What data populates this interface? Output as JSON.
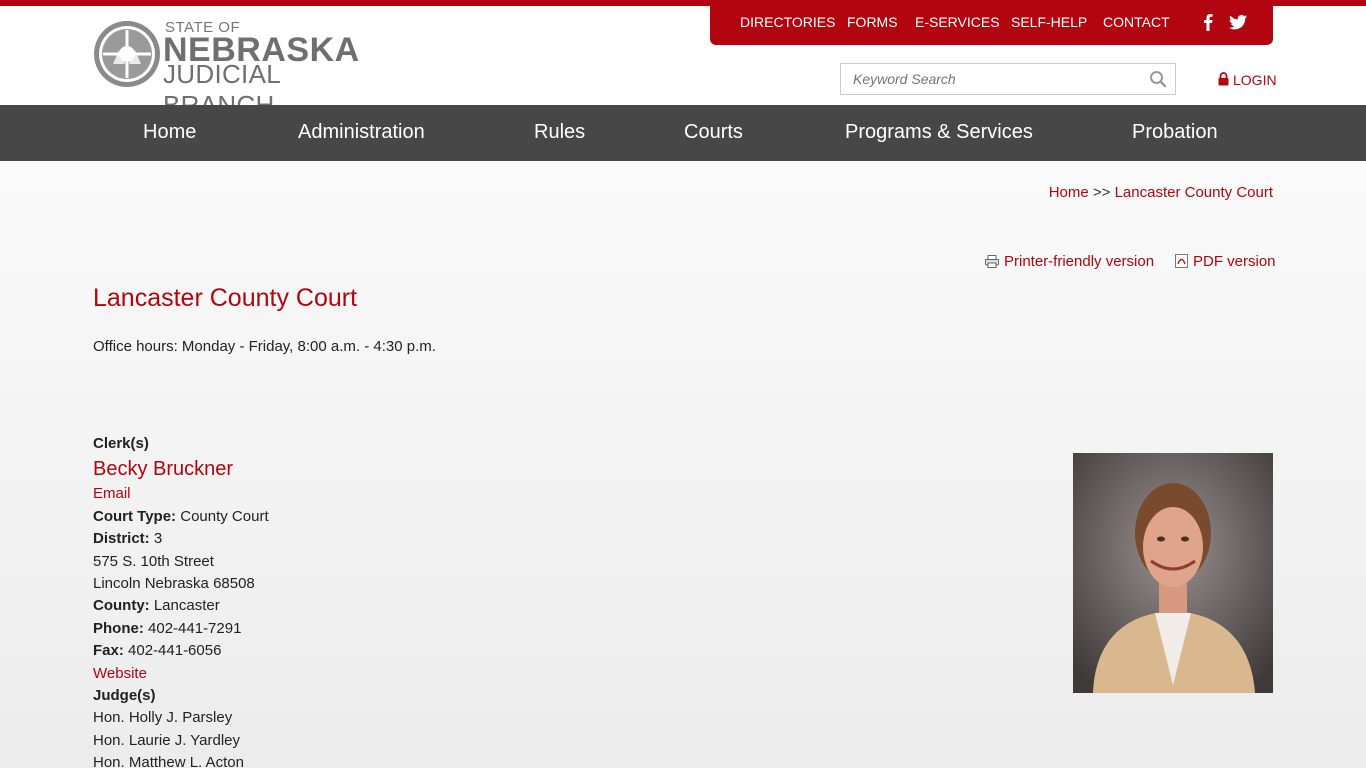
{
  "logo": {
    "line1": "STATE OF",
    "line2": "NEBRASKA",
    "line3": "JUDICIAL BRANCH"
  },
  "utility_nav": [
    "DIRECTORIES",
    "FORMS",
    "E-SERVICES",
    "SELF-HELP",
    "CONTACT"
  ],
  "social_icons": [
    "facebook-icon",
    "twitter-icon"
  ],
  "search": {
    "placeholder": "Keyword Search"
  },
  "login": {
    "label": "LOGIN"
  },
  "main_nav": [
    "Home",
    "Administration",
    "Rules",
    "Courts",
    "Programs & Services",
    "Probation"
  ],
  "breadcrumb": {
    "home": "Home",
    "separator": ">>",
    "current": "Lancaster County Court"
  },
  "page_tools": {
    "printer": "Printer-friendly version",
    "pdf": "PDF version"
  },
  "page_title": "Lancaster County Court",
  "office_hours": "Office hours:  Monday - Friday, 8:00 a.m. - 4:30 p.m.",
  "clerk": {
    "heading": "Clerk(s)",
    "name": "Becky Bruckner",
    "email_link": "Email",
    "court_type_label": "Court Type:",
    "court_type": "County Court",
    "district_label": "District:",
    "district": "3",
    "address1": "575 S. 10th Street",
    "address2": "Lincoln Nebraska 68508",
    "county_label": "County:",
    "county": "Lancaster",
    "phone_label": "Phone:",
    "phone": "402-441-7291",
    "fax_label": "Fax:",
    "fax": "402-441-6056",
    "website_link": "Website"
  },
  "judges": {
    "heading": "Judge(s)",
    "list": [
      "Hon. Holly J. Parsley",
      "Hon. Laurie J. Yardley",
      "Hon. Matthew L. Acton"
    ]
  },
  "colors": {
    "brand_red": "#b3050f",
    "nav_bg": "#474747"
  }
}
